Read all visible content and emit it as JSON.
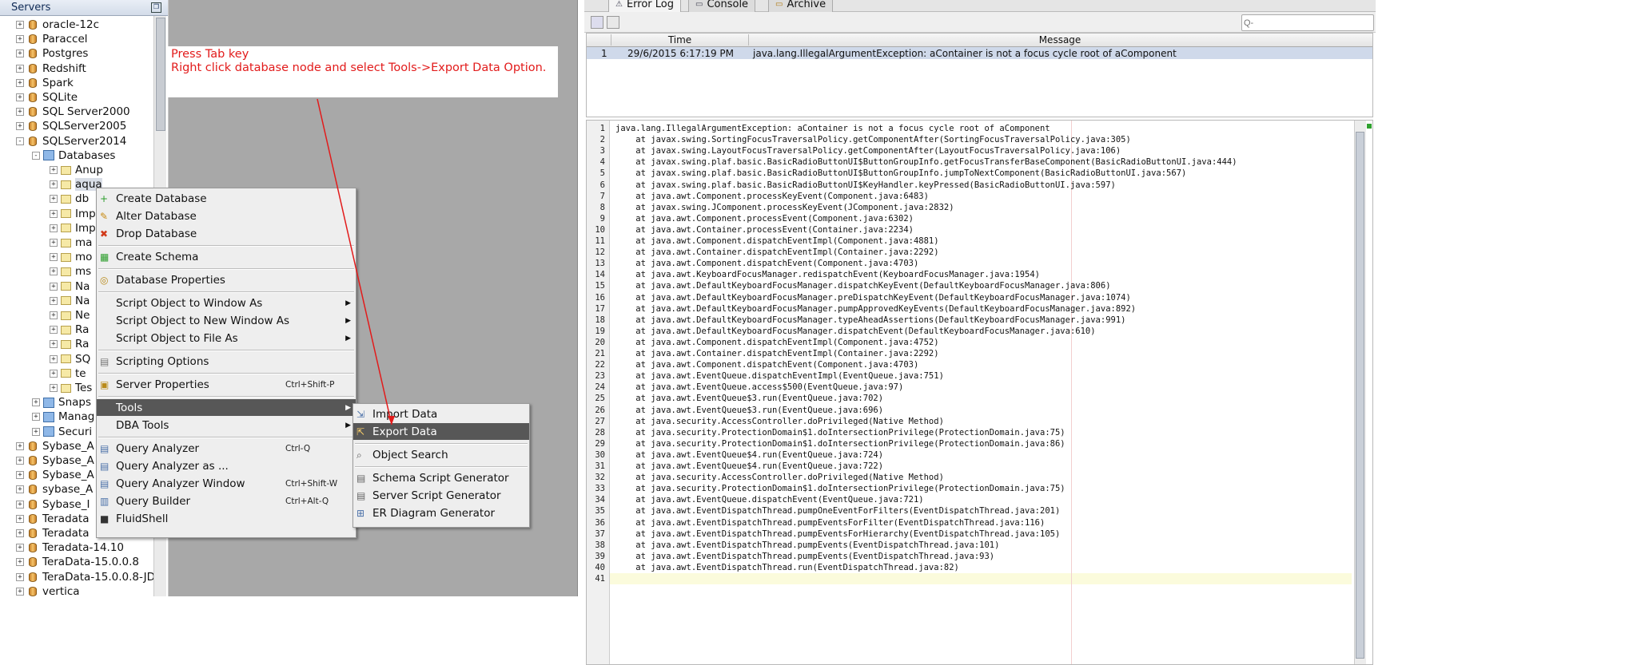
{
  "servers_panel": {
    "title": "Servers",
    "tree": [
      {
        "label": "oracle-12c",
        "level": 0,
        "toggle": "+",
        "icon": "db"
      },
      {
        "label": "Paraccel",
        "level": 0,
        "toggle": "+",
        "icon": "db"
      },
      {
        "label": "Postgres",
        "level": 0,
        "toggle": "+",
        "icon": "db"
      },
      {
        "label": "Redshift",
        "level": 0,
        "toggle": "+",
        "icon": "db"
      },
      {
        "label": "Spark",
        "level": 0,
        "toggle": "+",
        "icon": "db"
      },
      {
        "label": "SQLite",
        "level": 0,
        "toggle": "+",
        "icon": "db"
      },
      {
        "label": "SQL Server2000",
        "level": 0,
        "toggle": "+",
        "icon": "db"
      },
      {
        "label": "SQLServer2005",
        "level": 0,
        "toggle": "+",
        "icon": "db"
      },
      {
        "label": "SQLServer2014",
        "level": 0,
        "toggle": "-",
        "icon": "db"
      },
      {
        "label": "Databases",
        "level": 1,
        "toggle": "-",
        "icon": "dbgroup"
      },
      {
        "label": "Anup",
        "level": 2,
        "toggle": "+",
        "icon": "folder"
      },
      {
        "label": "aqua",
        "level": 2,
        "toggle": "+",
        "icon": "folder",
        "selected": true
      },
      {
        "label": "db",
        "level": 2,
        "toggle": "+",
        "icon": "folder"
      },
      {
        "label": "Imp",
        "level": 2,
        "toggle": "+",
        "icon": "folder"
      },
      {
        "label": "Imp",
        "level": 2,
        "toggle": "+",
        "icon": "folder"
      },
      {
        "label": "ma",
        "level": 2,
        "toggle": "+",
        "icon": "folder"
      },
      {
        "label": "mo",
        "level": 2,
        "toggle": "+",
        "icon": "folder"
      },
      {
        "label": "ms",
        "level": 2,
        "toggle": "+",
        "icon": "folder"
      },
      {
        "label": "Na",
        "level": 2,
        "toggle": "+",
        "icon": "folder"
      },
      {
        "label": "Na",
        "level": 2,
        "toggle": "+",
        "icon": "folder"
      },
      {
        "label": "Ne",
        "level": 2,
        "toggle": "+",
        "icon": "folder"
      },
      {
        "label": "Ra",
        "level": 2,
        "toggle": "+",
        "icon": "folder"
      },
      {
        "label": "Ra",
        "level": 2,
        "toggle": "+",
        "icon": "folder"
      },
      {
        "label": "SQ",
        "level": 2,
        "toggle": "+",
        "icon": "folder"
      },
      {
        "label": "te",
        "level": 2,
        "toggle": "+",
        "icon": "folder"
      },
      {
        "label": "Tes",
        "level": 2,
        "toggle": "+",
        "icon": "folder"
      },
      {
        "label": "Snaps",
        "level": 1,
        "toggle": "+",
        "icon": "dbgroup"
      },
      {
        "label": "Manag",
        "level": 1,
        "toggle": "+",
        "icon": "dbgroup"
      },
      {
        "label": "Securi",
        "level": 1,
        "toggle": "+",
        "icon": "dbgroup"
      },
      {
        "label": "Sybase_A",
        "level": 0,
        "toggle": "+",
        "icon": "db"
      },
      {
        "label": "Sybase_A",
        "level": 0,
        "toggle": "+",
        "icon": "db"
      },
      {
        "label": "Sybase_A",
        "level": 0,
        "toggle": "+",
        "icon": "db"
      },
      {
        "label": "sybase_A",
        "level": 0,
        "toggle": "+",
        "icon": "db"
      },
      {
        "label": "Sybase_I",
        "level": 0,
        "toggle": "+",
        "icon": "db"
      },
      {
        "label": "Teradata",
        "level": 0,
        "toggle": "+",
        "icon": "db"
      },
      {
        "label": "Teradata",
        "level": 0,
        "toggle": "+",
        "icon": "db"
      },
      {
        "label": "Teradata-14.10",
        "level": 0,
        "toggle": "+",
        "icon": "db"
      },
      {
        "label": "TeraData-15.0.0.8",
        "level": 0,
        "toggle": "+",
        "icon": "db"
      },
      {
        "label": "TeraData-15.0.0.8-JD",
        "level": 0,
        "toggle": "+",
        "icon": "db"
      },
      {
        "label": "vertica",
        "level": 0,
        "toggle": "+",
        "icon": "db"
      }
    ]
  },
  "annotation": {
    "line1": "Press Tab key",
    "line2": "Right click database node and select Tools->Export Data Option.",
    "color": "#e21b1b"
  },
  "context_menu": [
    {
      "type": "item",
      "label": "Create Database",
      "icon": "plus-icon",
      "shortcut": ""
    },
    {
      "type": "item",
      "label": "Alter Database",
      "icon": "pencil-icon",
      "shortcut": ""
    },
    {
      "type": "item",
      "label": "Drop Database",
      "icon": "delete-icon",
      "shortcut": ""
    },
    {
      "type": "sep"
    },
    {
      "type": "item",
      "label": "Create Schema",
      "icon": "schema-icon",
      "shortcut": ""
    },
    {
      "type": "sep"
    },
    {
      "type": "item",
      "label": "Database Properties",
      "icon": "properties-icon",
      "shortcut": ""
    },
    {
      "type": "sep"
    },
    {
      "type": "item",
      "label": "Script Object to Window As",
      "submenu": true
    },
    {
      "type": "item",
      "label": "Script Object to New Window As",
      "submenu": true
    },
    {
      "type": "item",
      "label": "Script Object to File As",
      "submenu": true
    },
    {
      "type": "sep"
    },
    {
      "type": "item",
      "label": "Scripting Options",
      "icon": "options-icon",
      "shortcut": ""
    },
    {
      "type": "sep"
    },
    {
      "type": "item",
      "label": "Server Properties",
      "icon": "server-icon",
      "shortcut": "Ctrl+Shift-P"
    },
    {
      "type": "sep"
    },
    {
      "type": "item",
      "label": "Tools",
      "submenu": true,
      "active": true
    },
    {
      "type": "item",
      "label": "DBA Tools",
      "submenu": true
    },
    {
      "type": "sep"
    },
    {
      "type": "item",
      "label": "Query Analyzer",
      "icon": "query-icon",
      "shortcut": "Ctrl-Q"
    },
    {
      "type": "item",
      "label": "Query Analyzer as ...",
      "icon": "query-icon",
      "shortcut": ""
    },
    {
      "type": "item",
      "label": "Query Analyzer Window",
      "icon": "query-icon",
      "shortcut": "Ctrl+Shift-W"
    },
    {
      "type": "item",
      "label": "Query Builder",
      "icon": "builder-icon",
      "shortcut": "Ctrl+Alt-Q"
    },
    {
      "type": "item",
      "label": "FluidShell",
      "icon": "shell-icon",
      "shortcut": ""
    }
  ],
  "tools_submenu": [
    {
      "type": "item",
      "label": "Import Data",
      "icon": "import-icon"
    },
    {
      "type": "item",
      "label": "Export Data",
      "icon": "export-icon",
      "active": true
    },
    {
      "type": "sep"
    },
    {
      "type": "item",
      "label": "Object Search",
      "icon": "search-icon"
    },
    {
      "type": "sep"
    },
    {
      "type": "item",
      "label": "Schema Script Generator",
      "icon": "script-icon"
    },
    {
      "type": "item",
      "label": "Server Script Generator",
      "icon": "script-icon"
    },
    {
      "type": "item",
      "label": "ER Diagram Generator",
      "icon": "diagram-icon"
    }
  ],
  "right_pane": {
    "tabs": [
      {
        "label": "Error Log",
        "active": true
      },
      {
        "label": "Console",
        "active": false
      },
      {
        "label": "Archive",
        "active": false
      }
    ],
    "filter_placeholder": "Q-",
    "table": {
      "columns": [
        "",
        "Time",
        "Message"
      ],
      "rows": [
        {
          "num": "1",
          "time": "29/6/2015 6:17:19 PM",
          "message": "java.lang.IllegalArgumentException: aContainer is not a focus cycle root of aComponent"
        }
      ]
    },
    "stack_trace": [
      "java.lang.IllegalArgumentException: aContainer is not a focus cycle root of aComponent",
      "    at javax.swing.SortingFocusTraversalPolicy.getComponentAfter(SortingFocusTraversalPolicy.java:305)",
      "    at javax.swing.LayoutFocusTraversalPolicy.getComponentAfter(LayoutFocusTraversalPolicy.java:106)",
      "    at javax.swing.plaf.basic.BasicRadioButtonUI$ButtonGroupInfo.getFocusTransferBaseComponent(BasicRadioButtonUI.java:444)",
      "    at javax.swing.plaf.basic.BasicRadioButtonUI$ButtonGroupInfo.jumpToNextComponent(BasicRadioButtonUI.java:567)",
      "    at javax.swing.plaf.basic.BasicRadioButtonUI$KeyHandler.keyPressed(BasicRadioButtonUI.java:597)",
      "    at java.awt.Component.processKeyEvent(Component.java:6483)",
      "    at javax.swing.JComponent.processKeyEvent(JComponent.java:2832)",
      "    at java.awt.Component.processEvent(Component.java:6302)",
      "    at java.awt.Container.processEvent(Container.java:2234)",
      "    at java.awt.Component.dispatchEventImpl(Component.java:4881)",
      "    at java.awt.Container.dispatchEventImpl(Container.java:2292)",
      "    at java.awt.Component.dispatchEvent(Component.java:4703)",
      "    at java.awt.KeyboardFocusManager.redispatchEvent(KeyboardFocusManager.java:1954)",
      "    at java.awt.DefaultKeyboardFocusManager.dispatchKeyEvent(DefaultKeyboardFocusManager.java:806)",
      "    at java.awt.DefaultKeyboardFocusManager.preDispatchKeyEvent(DefaultKeyboardFocusManager.java:1074)",
      "    at java.awt.DefaultKeyboardFocusManager.pumpApprovedKeyEvents(DefaultKeyboardFocusManager.java:892)",
      "    at java.awt.DefaultKeyboardFocusManager.typeAheadAssertions(DefaultKeyboardFocusManager.java:991)",
      "    at java.awt.DefaultKeyboardFocusManager.dispatchEvent(DefaultKeyboardFocusManager.java:610)",
      "    at java.awt.Component.dispatchEventImpl(Component.java:4752)",
      "    at java.awt.Container.dispatchEventImpl(Container.java:2292)",
      "    at java.awt.Component.dispatchEvent(Component.java:4703)",
      "    at java.awt.EventQueue.dispatchEventImpl(EventQueue.java:751)",
      "    at java.awt.EventQueue.access$500(EventQueue.java:97)",
      "    at java.awt.EventQueue$3.run(EventQueue.java:702)",
      "    at java.awt.EventQueue$3.run(EventQueue.java:696)",
      "    at java.security.AccessController.doPrivileged(Native Method)",
      "    at java.security.ProtectionDomain$1.doIntersectionPrivilege(ProtectionDomain.java:75)",
      "    at java.security.ProtectionDomain$1.doIntersectionPrivilege(ProtectionDomain.java:86)",
      "    at java.awt.EventQueue$4.run(EventQueue.java:724)",
      "    at java.awt.EventQueue$4.run(EventQueue.java:722)",
      "    at java.security.AccessController.doPrivileged(Native Method)",
      "    at java.security.ProtectionDomain$1.doIntersectionPrivilege(ProtectionDomain.java:75)",
      "    at java.awt.EventQueue.dispatchEvent(EventQueue.java:721)",
      "    at java.awt.EventDispatchThread.pumpOneEventForFilters(EventDispatchThread.java:201)",
      "    at java.awt.EventDispatchThread.pumpEventsForFilter(EventDispatchThread.java:116)",
      "    at java.awt.EventDispatchThread.pumpEventsForHierarchy(EventDispatchThread.java:105)",
      "    at java.awt.EventDispatchThread.pumpEvents(EventDispatchThread.java:101)",
      "    at java.awt.EventDispatchThread.pumpEvents(EventDispatchThread.java:93)",
      "    at java.awt.EventDispatchThread.run(EventDispatchThread.java:82)",
      ""
    ]
  }
}
